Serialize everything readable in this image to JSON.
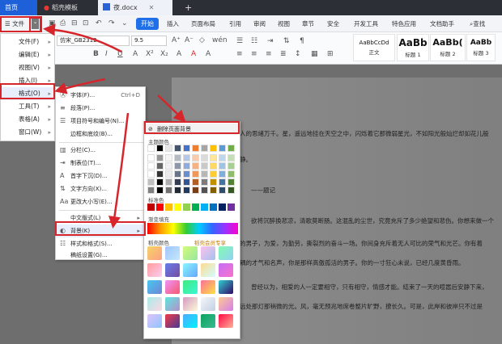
{
  "tabbar": {
    "home": "首页",
    "template": "稻壳模板",
    "doc": "夜.docx",
    "add": "+"
  },
  "menubar": {
    "file": "文件",
    "start": "开始",
    "items": [
      "插入",
      "页面布局",
      "引用",
      "审阅",
      "视图",
      "章节",
      "安全",
      "开发工具",
      "特色应用",
      "文档助手"
    ],
    "search": "查找"
  },
  "toolbar": {
    "font_name": "仿宋_GB2312",
    "font_size": "9.5",
    "styles": [
      {
        "preview": "AaBbCcDd",
        "label": "正文"
      },
      {
        "preview": "AaBb",
        "label": "标题 1"
      },
      {
        "preview": "AaBb(",
        "label": "标题 2"
      },
      {
        "preview": "AaBb",
        "label": "标题 3"
      }
    ]
  },
  "filemenu": {
    "items": [
      "文件(F)",
      "编辑(E)",
      "视图(V)",
      "插入(I)",
      "格式(O)",
      "工具(T)",
      "表格(A)",
      "窗口(W)"
    ]
  },
  "formatmenu": {
    "items": [
      {
        "label": "字体(F)...",
        "shortcut": "Ctrl+D"
      },
      {
        "label": "段落(P)...",
        "shortcut": ""
      },
      {
        "label": "项目符号和编号(N)...",
        "shortcut": ""
      },
      {
        "label": "边框和底纹(B)...",
        "shortcut": ""
      },
      {
        "label": "分栏(C)...",
        "shortcut": ""
      },
      {
        "label": "制表位(T)...",
        "shortcut": ""
      },
      {
        "label": "首字下沉(D)...",
        "shortcut": ""
      },
      {
        "label": "文字方向(X)...",
        "shortcut": ""
      },
      {
        "label": "更改大小写(E)...",
        "shortcut": ""
      },
      {
        "label": "中文版式(L)",
        "shortcut": ""
      },
      {
        "label": "背景(K)",
        "shortcut": ""
      },
      {
        "label": "样式和格式(S)...",
        "shortcut": ""
      },
      {
        "label": "稿纸设置(G)...",
        "shortcut": ""
      }
    ]
  },
  "bgpanel": {
    "remove": "删除页面背景",
    "theme": "主题颜色",
    "standard": "标准色",
    "gradient": "渐变填充",
    "shell_colors": "稻壳颜色",
    "member": "稻壳会员专享"
  },
  "document": {
    "lines": [
      "人的思绪万千。星，遥远地挂在天空之中，闪烁着它那微弱星光，不如阳光般灿烂却如花儿般",
      "静。",
      "——题记",
      "欲将沉醉换悲凉，清歌莫断肠。这混乱的尘世，究竟充斥了多少绝望和悲伤。你想来做一个",
      "的男子，为爱，为勤劳，撕裂烈的奋斗一场。你间身充斥着无人可比的荣气和光芒。你有着",
      "耦的才气和名声，你是那样高傲孤活的男子。你的一寸狂心未说，已经几度黄昏雨。",
      "曾经以为，相爱的人一定要相守，只有相守，情感才能。结束了一天的喧嚣后安静下来，",
      "远处那灯那稍微的光。风，毫无预兆地席卷整片旷野，撩长久。可是，此岸和彼岸只不过是"
    ]
  },
  "colors": {
    "accent": "#1e6fe8",
    "highlight": "#d6262b",
    "theme_top": [
      "#ffffff",
      "#000000",
      "#e7e6e6",
      "#44546a",
      "#4472c4",
      "#ed7d31",
      "#a5a5a5",
      "#ffc000",
      "#5b9bd5",
      "#70ad47"
    ],
    "standard": [
      "#c00000",
      "#ff0000",
      "#ffc000",
      "#ffff00",
      "#92d050",
      "#00b050",
      "#00b0f0",
      "#0070c0",
      "#002060",
      "#7030a0"
    ]
  }
}
